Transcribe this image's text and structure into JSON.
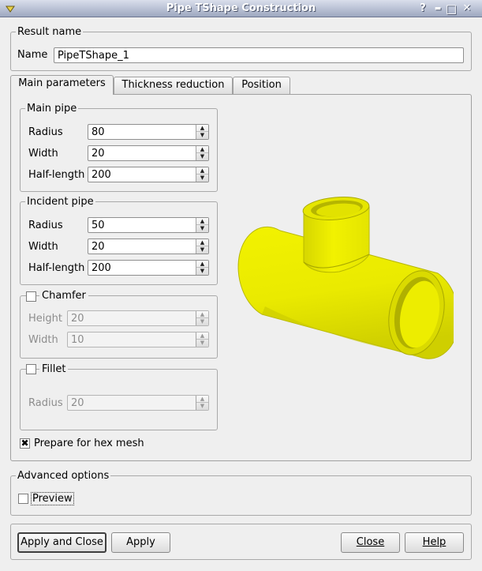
{
  "window": {
    "title": "Pipe TShape Construction",
    "help_glyph": "?",
    "min_glyph": "▬",
    "max_glyph": "□",
    "close_glyph": "✕"
  },
  "result": {
    "group_title": "Result name",
    "name_label": "Name",
    "name_value": "PipeTShape_1"
  },
  "tabs": [
    {
      "label": "Main parameters"
    },
    {
      "label": "Thickness reduction"
    },
    {
      "label": "Position"
    }
  ],
  "main_pipe": {
    "title": "Main pipe",
    "radius_label": "Radius",
    "radius_value": "80",
    "width_label": "Width",
    "width_value": "20",
    "half_length_label": "Half-length",
    "half_length_value": "200"
  },
  "incident_pipe": {
    "title": "Incident pipe",
    "radius_label": "Radius",
    "radius_value": "50",
    "width_label": "Width",
    "width_value": "20",
    "half_length_label": "Half-length",
    "half_length_value": "200"
  },
  "chamfer": {
    "title": "Chamfer",
    "height_label": "Height",
    "height_value": "20",
    "width_label": "Width",
    "width_value": "10"
  },
  "fillet": {
    "title": "Fillet",
    "radius_label": "Radius",
    "radius_value": "20"
  },
  "hex_mesh": {
    "label": "Prepare for hex mesh",
    "check_glyph": "✖"
  },
  "advanced": {
    "title": "Advanced options",
    "preview_label": "Preview"
  },
  "buttons": {
    "apply_close": "Apply and Close",
    "apply": "Apply",
    "close": "Close",
    "help": "Help"
  },
  "colors": {
    "pipe": "#f2f200",
    "pipe_shadow": "#a7a700"
  }
}
